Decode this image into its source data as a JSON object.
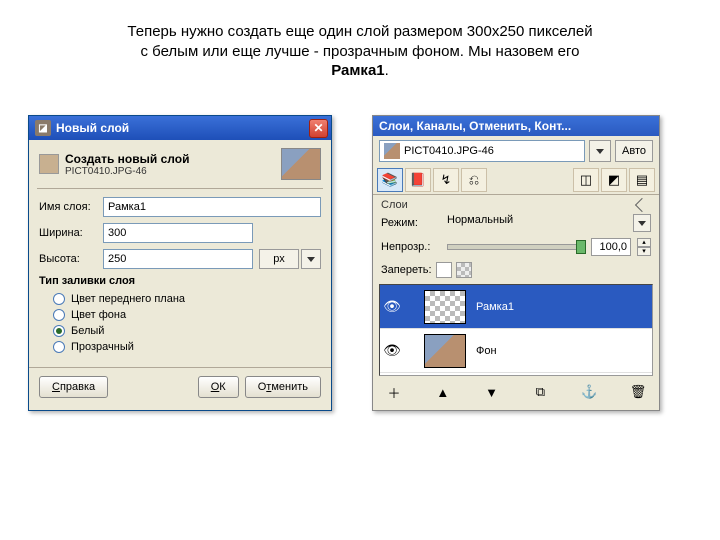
{
  "instruction": {
    "line1": "Теперь нужно создать еще один слой размером 300х250 пикселей",
    "line2": "с белым или еще лучше - прозрачным фоном. Мы назовем его",
    "line3_bold": "Рамка1",
    "line3_suffix": "."
  },
  "dialog": {
    "title": "Новый слой",
    "heading": "Создать новый слой",
    "subheading": "PICT0410.JPG-46",
    "labels": {
      "name": "Имя слоя:",
      "width": "Ширина:",
      "height": "Высота:",
      "unit": "px",
      "fill_section": "Тип заливки слоя"
    },
    "values": {
      "name": "Рамка1",
      "width": "300",
      "height": "250"
    },
    "fill_options": {
      "fg": "Цвет переднего плана",
      "bg": "Цвет фона",
      "white": "Белый",
      "transparent": "Прозрачный"
    },
    "buttons": {
      "help": "Справка",
      "help_u": "С",
      "ok": "ОК",
      "ok_u": "О",
      "cancel": "Отменить",
      "cancel_u": "т"
    }
  },
  "panel": {
    "title": "Слои, Каналы, Отменить, Конт...",
    "image_combo": "PICT0410.JPG-46",
    "auto": "Авто",
    "tab_layers": "Слои",
    "mode_label": "Режим:",
    "mode_value": "Нормальный",
    "opacity_label": "Непрозр.:",
    "opacity_value": "100,0",
    "lock_label": "Запереть:",
    "layers": [
      {
        "name": "Рамка1"
      },
      {
        "name": "Фон"
      }
    ],
    "icons": {
      "layers": "📚",
      "channels": "📕",
      "paths": "↯",
      "undo": "⎌",
      "sel": "◫",
      "brush": "◩",
      "grad": "▤",
      "new": "＋",
      "up": "▲",
      "down": "▼",
      "dup": "⧉",
      "anchor": "⚓",
      "del": "🗑"
    }
  }
}
